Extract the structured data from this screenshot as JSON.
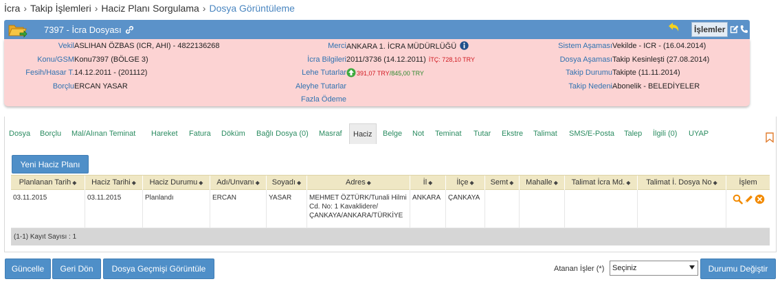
{
  "breadcrumb": {
    "items": [
      "İcra",
      "Takip İşlemleri",
      "Haciz Planı Sorgulama"
    ],
    "current": "Dosya Görüntüleme",
    "separator": "›"
  },
  "header": {
    "title": "7397 - İcra Dosyası",
    "actions_label": "İşlemler"
  },
  "info": {
    "vekil": {
      "label": "Vekil",
      "value": "ASLIHAN ÖZBAS (ICR, AHI) - 4822136268"
    },
    "konu": {
      "label": "Konu/GSM",
      "value": "Konu7397 (BÖLGE 3)"
    },
    "fesih": {
      "label": "Fesih/Hasar T.",
      "value": "14.12.2011 - (201112)"
    },
    "borclu": {
      "label": "Borçlu",
      "value": "ERCAN YASAR"
    },
    "merci": {
      "label": "Merci",
      "value": "ANKARA 1. İCRA MÜDÜRLÜĞÜ"
    },
    "icra_bilgileri": {
      "label": "İcra Bilgileri",
      "value": "2011/3736 (14.12.2011)",
      "itc": "İTÇ: 728,10 TRY"
    },
    "lehe": {
      "label": "Lehe Tutarlar",
      "red": "391,07 TRY",
      "slash": "/",
      "green": "845,00 TRY"
    },
    "aleyhe": {
      "label": "Aleyhe Tutarlar",
      "value": ""
    },
    "fazla": {
      "label": "Fazla Ödeme",
      "value": ""
    },
    "sistem": {
      "label": "Sistem Aşaması",
      "value": "Vekilde - ICR - (16.04.2014)"
    },
    "dosya_asamasi": {
      "label": "Dosya Aşaması",
      "value": "Takip Kesinleşti (27.08.2014)"
    },
    "takip_durumu": {
      "label": "Takip Durumu",
      "value": "Takipte (11.11.2014)"
    },
    "takip_nedeni": {
      "label": "Takip Nedeni",
      "value": "Abonelik - BELEDİYELER"
    }
  },
  "tabs": [
    {
      "label": "Dosya"
    },
    {
      "label": "Borçlu"
    },
    {
      "label": "Mal/Alınan Teminat"
    },
    {
      "label": "Hareket"
    },
    {
      "label": "Fatura"
    },
    {
      "label": "Döküm"
    },
    {
      "label": "Bağlı Dosya (0)"
    },
    {
      "label": "Masraf"
    },
    {
      "label": "Haciz"
    },
    {
      "label": "Belge"
    },
    {
      "label": "Not"
    },
    {
      "label": "Teminat"
    },
    {
      "label": "Tutar"
    },
    {
      "label": "Ekstre"
    },
    {
      "label": "Talimat"
    },
    {
      "label": "SMS/E-Posta"
    },
    {
      "label": "Talep"
    },
    {
      "label": "İlgili (0)"
    },
    {
      "label": "UYAP"
    }
  ],
  "new_plan_label": "Yeni Haciz Planı",
  "sort_glyph": "◆",
  "table": {
    "columns": [
      "Planlanan Tarih",
      "Haciz Tarihi",
      "Haciz Durumu",
      "Adı/Unvanı",
      "Soyadı",
      "Adres",
      "İl",
      "İlçe",
      "Semt",
      "Mahalle",
      "Talimat İcra Md.",
      "Talimat İ. Dosya No",
      "İşlem"
    ],
    "rows": [
      {
        "planlanan_tarih": "03.11.2015",
        "haciz_tarihi": "03.11.2015",
        "haciz_durumu": "Planlandı",
        "adi": "ERCAN",
        "soyadi": "YASAR",
        "adres": "MEHMET ÖZTÜRK/Tunali Hilmi Cd. No: 1 Kavaklidere/ ÇANKAYA/ANKARA/TÜRKİYE",
        "il": "ANKARA",
        "ilce": "ÇANKAYA",
        "semt": "",
        "mahalle": "",
        "talimat_icra": "",
        "talimat_dosya": ""
      }
    ],
    "footer": "(1-1) Kayıt Sayısı : 1"
  },
  "buttons": {
    "guncelle": "Güncelle",
    "geri_don": "Geri Dön",
    "gecmis": "Dosya Geçmişi Görüntüle",
    "durumu_degistir": "Durumu Değiştir"
  },
  "assign": {
    "label": "Atanan İşler (*)",
    "selected": "Seçiniz"
  },
  "colors": {
    "header_blue": "#5b92c9",
    "info_pink": "#fcd3d3",
    "label_blue": "#2f72b0",
    "tab_green": "#2a8b60",
    "button_blue": "#4f8fc8",
    "grid_header": "#efe7c4",
    "action_orange": "#f28a00"
  }
}
